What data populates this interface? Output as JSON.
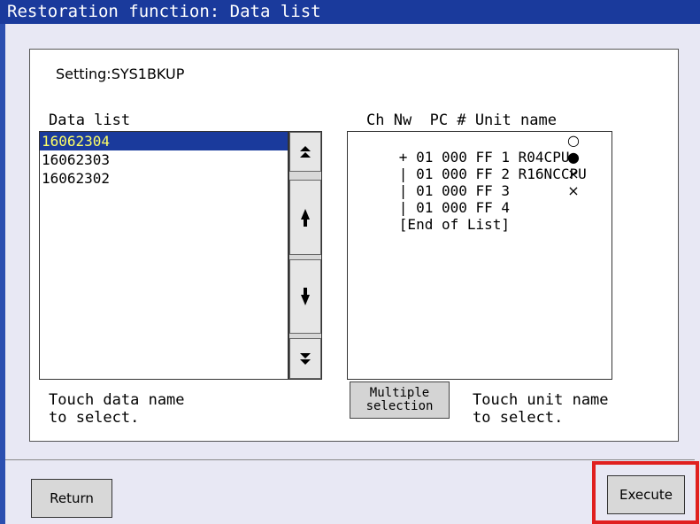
{
  "window": {
    "title": "Restoration function: Data list"
  },
  "setting": {
    "label": "Setting:",
    "value": "SYS1BKUP"
  },
  "data_list": {
    "label": "Data list",
    "items": [
      "16062304",
      "16062303",
      "16062302"
    ],
    "selected_index": 0,
    "hint": "Touch data name\nto select."
  },
  "scroll_buttons": {
    "top_icon": "double-up-arrow-icon",
    "up_icon": "up-arrow-icon",
    "down_icon": "down-arrow-icon",
    "bottom_icon": "double-down-arrow-icon"
  },
  "unit_list": {
    "header": "Ch Nw  PC # Unit name",
    "rows": [
      {
        "text": "+ 01 000 FF 1 R04CPU",
        "mark": "○"
      },
      {
        "text": "| 01 000 FF 2 R16NCCPU",
        "mark": "●"
      },
      {
        "text": "| 01 000 FF 3",
        "mark": "×"
      },
      {
        "text": "| 01 000 FF 4",
        "mark": "×"
      },
      {
        "text": "[End of List]",
        "mark": ""
      }
    ],
    "hint": "Touch unit name\nto select."
  },
  "buttons": {
    "multiple_selection_line1": "Multiple",
    "multiple_selection_line2": "selection",
    "return": "Return",
    "execute": "Execute"
  },
  "colors": {
    "title_bar": "#1a3a9c",
    "selection_bg": "#1a3a9c",
    "selection_text": "#ffff66",
    "highlight_border": "#e02020"
  }
}
